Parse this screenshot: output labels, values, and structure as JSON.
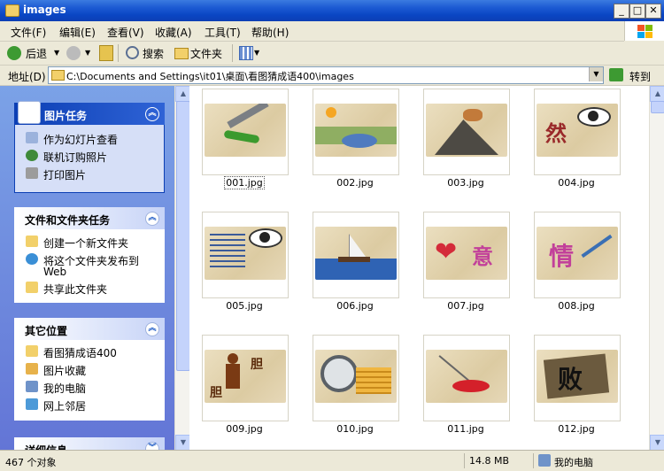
{
  "window": {
    "title": "images"
  },
  "menu": [
    {
      "label": "文件(F)"
    },
    {
      "label": "编辑(E)"
    },
    {
      "label": "查看(V)"
    },
    {
      "label": "收藏(A)"
    },
    {
      "label": "工具(T)"
    },
    {
      "label": "帮助(H)"
    }
  ],
  "toolbar": {
    "back_label": "后退",
    "search_label": "搜索",
    "folders_label": "文件夹"
  },
  "address": {
    "label": "地址(D)",
    "value": "C:\\Documents and Settings\\it01\\桌面\\看图猜成语400\\images",
    "go_label": "转到"
  },
  "tasks": {
    "picture_tasks": {
      "title": "图片任务",
      "items": [
        "作为幻灯片查看",
        "联机订购照片",
        "打印图片"
      ]
    },
    "file_tasks": {
      "title": "文件和文件夹任务",
      "items": [
        "创建一个新文件夹",
        "将这个文件夹发布到",
        "Web",
        "共享此文件夹"
      ]
    },
    "other_places": {
      "title": "其它位置",
      "items": [
        "看图猜成语400",
        "图片收藏",
        "我的电脑",
        "网上邻居"
      ]
    },
    "details": {
      "title": "详细信息"
    }
  },
  "files": [
    {
      "name": "001.jpg"
    },
    {
      "name": "002.jpg"
    },
    {
      "name": "003.jpg"
    },
    {
      "name": "004.jpg"
    },
    {
      "name": "005.jpg"
    },
    {
      "name": "006.jpg"
    },
    {
      "name": "007.jpg"
    },
    {
      "name": "008.jpg"
    },
    {
      "name": "009.jpg"
    },
    {
      "name": "010.jpg"
    },
    {
      "name": "011.jpg"
    },
    {
      "name": "012.jpg"
    }
  ],
  "thumb_text": {
    "ran": "然",
    "yi": "意",
    "qing": "情",
    "bai": "败",
    "dan": "胆"
  },
  "status": {
    "count": "467 个对象",
    "size": "14.8 MB",
    "location": "我的电脑"
  },
  "colors": {
    "title_blue": "#0a46c4",
    "task_header": "#215dc6",
    "pane_bg": "#7ba2e7"
  }
}
